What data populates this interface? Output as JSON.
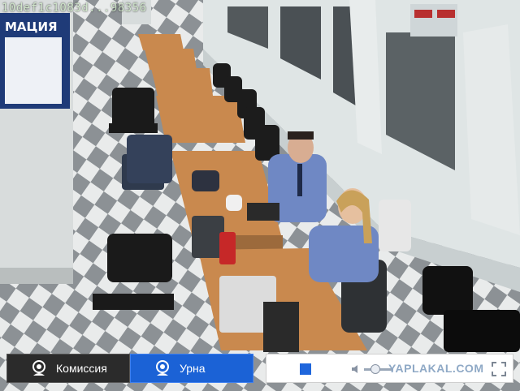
{
  "osd": {
    "stream_id": "10def1c1083d...98356"
  },
  "scene": {
    "info_board_text": "МАЦИЯ",
    "colors": {
      "wall": "#dfe5e5",
      "floor_light": "#e9ebeb",
      "floor_dark": "#8c9195",
      "table": "#c9894e",
      "shirt": "#6f88c4",
      "board": "#1f3b78"
    }
  },
  "tabs": [
    {
      "label": "Комиссия",
      "icon": "camera-icon",
      "active": false
    },
    {
      "label": "Урна",
      "icon": "camera-icon",
      "active": true
    }
  ],
  "controls": {
    "stop_icon": "stop-icon",
    "volume_icon": "speaker-icon",
    "volume": 0.4,
    "watermark": "YAPLAKAL.COM",
    "fullscreen_icon": "fullscreen-icon"
  },
  "colors": {
    "accent": "#1b62d6",
    "tab_dark": "#2b2b2b"
  }
}
